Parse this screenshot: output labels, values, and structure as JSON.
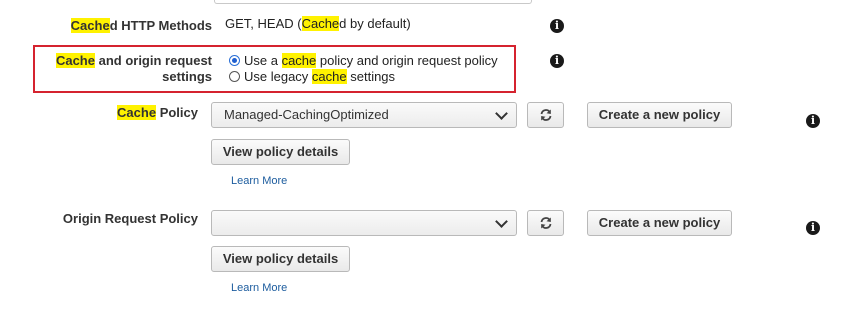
{
  "cached_methods": {
    "label_hl": "Cache",
    "label_rest": "d HTTP Methods",
    "value_pre": "GET, HEAD (",
    "value_hl": "Cache",
    "value_post": "d by default)"
  },
  "cache_origin": {
    "label_hl": "Cache",
    "label_line1_rest": " and origin request",
    "label_line2": "settings",
    "option1_pre": "Use a ",
    "option1_hl": "cache",
    "option1_post": " policy and origin request policy",
    "option2_pre": "Use legacy ",
    "option2_hl": "cache",
    "option2_post": " settings"
  },
  "cache_policy": {
    "label_hl": "Cache",
    "label_rest": " Policy",
    "selected": "Managed-CachingOptimized",
    "create_label": "Create a new policy",
    "view_label": "View policy details",
    "learn_more": "Learn More"
  },
  "origin_policy": {
    "label": "Origin Request Policy",
    "selected": "",
    "create_label": "Create a new policy",
    "view_label": "View policy details",
    "learn_more": "Learn More"
  },
  "icons": {
    "info": "info-icon",
    "refresh": "refresh-icon",
    "dropdown": "chevron-down-icon"
  },
  "colors": {
    "highlight": "#fff200",
    "red_box": "#d5232f",
    "link": "#1c5c9e"
  }
}
